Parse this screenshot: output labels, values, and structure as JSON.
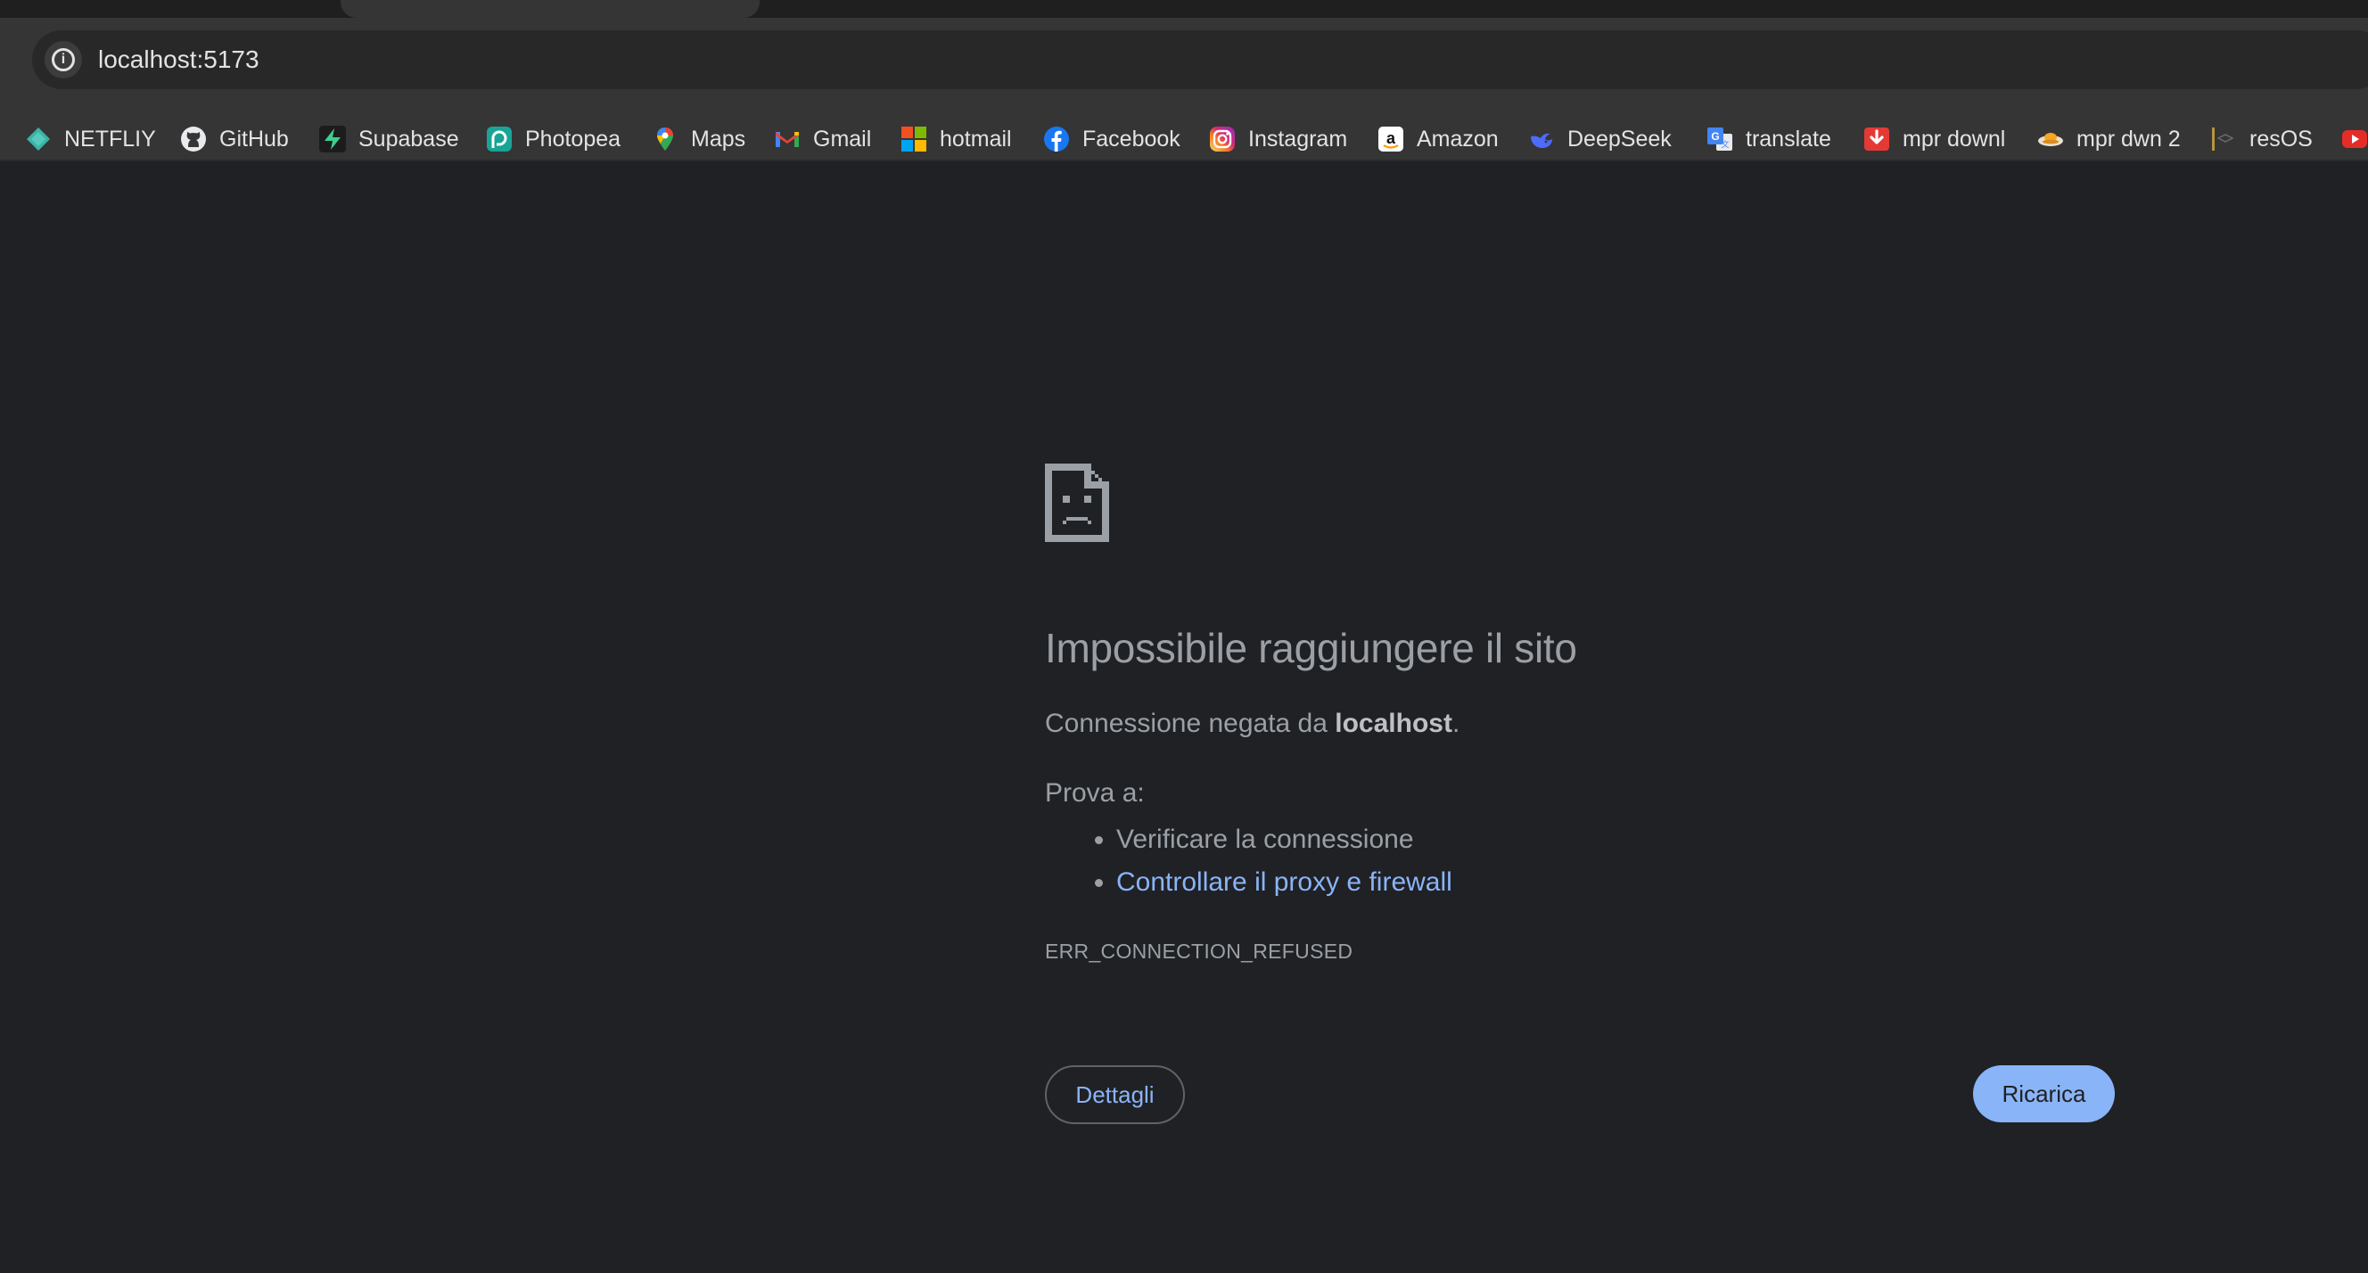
{
  "browser": {
    "address_bar": {
      "url": "localhost:5173"
    },
    "bookmarks": [
      {
        "label": "NETFLIY",
        "icon": "netlify-diamond-icon"
      },
      {
        "label": "GitHub",
        "icon": "github-icon"
      },
      {
        "label": "Supabase",
        "icon": "supabase-bolt-icon"
      },
      {
        "label": "Photopea",
        "icon": "photopea-icon"
      },
      {
        "label": "Maps",
        "icon": "maps-pin-icon"
      },
      {
        "label": "Gmail",
        "icon": "gmail-icon"
      },
      {
        "label": "hotmail",
        "icon": "microsoft-squares-icon"
      },
      {
        "label": "Facebook",
        "icon": "facebook-icon"
      },
      {
        "label": "Instagram",
        "icon": "instagram-icon"
      },
      {
        "label": "Amazon",
        "icon": "amazon-icon"
      },
      {
        "label": "DeepSeek",
        "icon": "deepseek-whale-icon"
      },
      {
        "label": "translate",
        "icon": "google-translate-icon"
      },
      {
        "label": "mpr downl",
        "icon": "download-arrow-icon"
      },
      {
        "label": "mpr dwn 2",
        "icon": "saucer-icon"
      },
      {
        "label": "resOS",
        "icon": "resos-icon"
      }
    ]
  },
  "error_page": {
    "icon": "sad-document-icon",
    "title": "Impossibile raggiungere il sito",
    "description_prefix": "Connessione negata da ",
    "description_host": "localhost",
    "description_suffix": ".",
    "try_label": "Prova a:",
    "suggestions": [
      {
        "text": "Verificare la connessione",
        "is_link": false
      },
      {
        "text": "Controllare il proxy e firewall",
        "is_link": true
      }
    ],
    "error_code": "ERR_CONNECTION_REFUSED",
    "details_button": "Dettagli",
    "reload_button": "Ricarica"
  },
  "colors": {
    "page_background": "#202124",
    "toolbar_background": "#353535",
    "text_secondary": "#9aa0a6",
    "link_blue": "#8ab4f8"
  }
}
